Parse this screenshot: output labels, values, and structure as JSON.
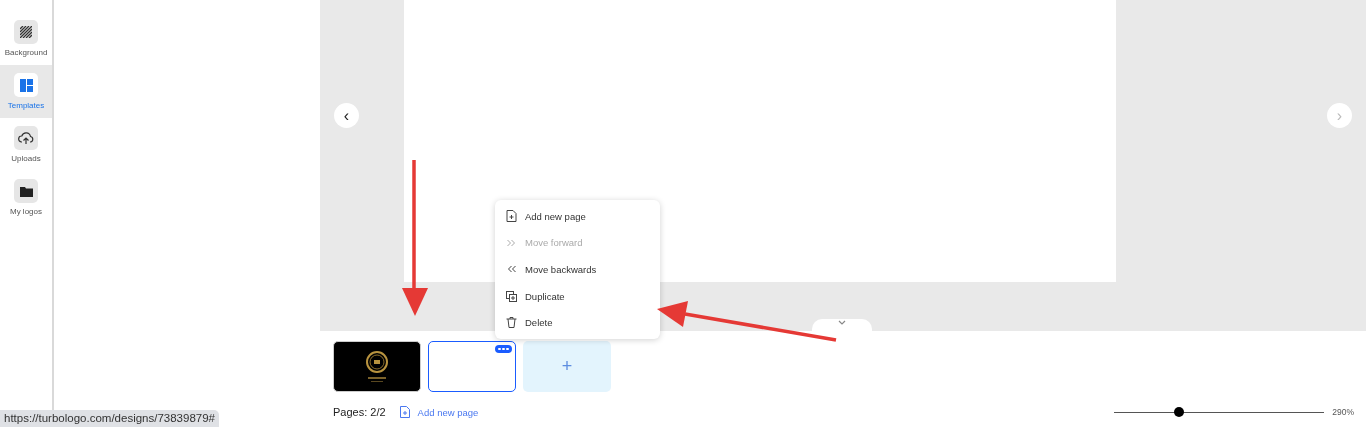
{
  "sidebar": {
    "items": [
      {
        "label": "Background",
        "kind": "stripes",
        "selected": false
      },
      {
        "label": "Templates",
        "kind": "grid",
        "selected": true
      },
      {
        "label": "Uploads",
        "kind": "upload",
        "selected": false
      },
      {
        "label": "My logos",
        "kind": "folder",
        "selected": false
      }
    ]
  },
  "canvas": {
    "prev_arrow": "‹",
    "next_arrow": "›"
  },
  "context_menu": {
    "items": [
      {
        "label": "Add new page",
        "kind": "page",
        "disabled": false
      },
      {
        "label": "Move forward",
        "kind": "forward",
        "disabled": true
      },
      {
        "label": "Move backwards",
        "kind": "backward",
        "disabled": false
      },
      {
        "label": "Duplicate",
        "kind": "copy",
        "disabled": false
      },
      {
        "label": "Delete",
        "kind": "trash",
        "disabled": false
      }
    ]
  },
  "pages": {
    "thumbnails": [
      {
        "kind": "logo",
        "selected": false
      },
      {
        "kind": "blank",
        "selected": true
      }
    ],
    "add_button": "+",
    "counter": "Pages: 2/2",
    "add_link": "Add new page"
  },
  "zoom": {
    "level": 0.31,
    "reading": "290%"
  },
  "status_url": "https://turbologo.com/designs/73839879#"
}
